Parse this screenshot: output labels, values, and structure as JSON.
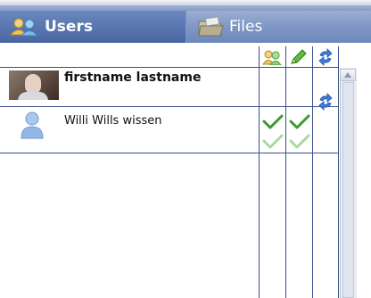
{
  "tabs": {
    "users": {
      "label": "Users",
      "icon": "users-icon",
      "active": true
    },
    "files": {
      "label": "Files",
      "icon": "folder-icon",
      "active": false
    }
  },
  "columns": [
    {
      "icon": "group-icon"
    },
    {
      "icon": "edit-pencil-icon"
    },
    {
      "icon": "sync-icon"
    }
  ],
  "users": [
    {
      "name": "firstname lastname",
      "avatar": "photo",
      "bold": true,
      "perm_group": true,
      "perm_edit": true,
      "perm_sync": true
    },
    {
      "name": "Willi Wills wissen",
      "avatar": "generic-user",
      "bold": false,
      "perm_group": true,
      "perm_edit": true,
      "perm_sync": false
    }
  ],
  "colors": {
    "tab_bar": "#4a66a2",
    "grid_line": "#3b4f8c",
    "check_active": "#3c9a2e",
    "check_inactive": "#a8d8a0",
    "sync_blue": "#2f66c7"
  }
}
